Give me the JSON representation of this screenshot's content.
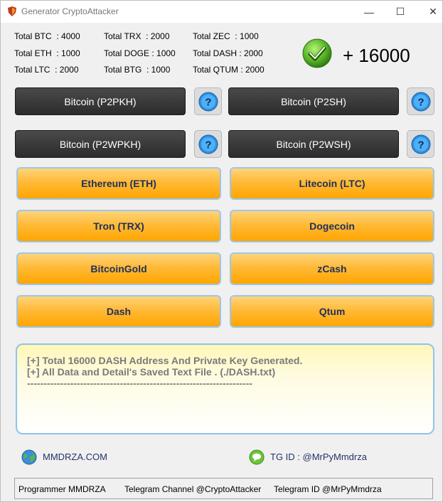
{
  "window": {
    "title": "Generator CryptoAttacker",
    "controls": {
      "minimize": "—",
      "maximize": "☐",
      "close": "✕"
    }
  },
  "totals": [
    [
      "Total BTC  : 4000",
      "Total TRX  : 2000",
      "Total ZEC  : 1000"
    ],
    [
      "Total ETH  : 1000",
      "Total DOGE : 1000",
      "Total DASH : 2000"
    ],
    [
      "Total LTC  : 2000",
      "Total BTG  : 1000",
      "Total QTUM : 2000"
    ]
  ],
  "counter": "+ 16000",
  "bitcoin_buttons": [
    {
      "label": "Bitcoin (P2PKH)"
    },
    {
      "label": "Bitcoin (P2SH)"
    },
    {
      "label": "Bitcoin (P2WPKH)"
    },
    {
      "label": "Bitcoin (P2WSH)"
    }
  ],
  "help_label": "?",
  "coin_buttons": [
    {
      "label": "Ethereum (ETH)"
    },
    {
      "label": "Litecoin (LTC)"
    },
    {
      "label": "Tron (TRX)"
    },
    {
      "label": "Dogecoin"
    },
    {
      "label": "BitcoinGold"
    },
    {
      "label": "zCash"
    },
    {
      "label": "Dash"
    },
    {
      "label": "Qtum"
    }
  ],
  "log": {
    "lines": [
      "[+] Total 16000 DASH Address And Private Key Generated.",
      "[+] All Data and Detail's Saved Text File . (./DASH.txt)",
      "--------------------------------------------------------------------"
    ]
  },
  "links": {
    "website": "MMDRZA.COM",
    "telegram": "TG ID : @MrPyMmdrza"
  },
  "status": {
    "programmer": "Programmer MMDRZA",
    "channel": "Telegram Channel @CryptoAttacker",
    "telegram_id": "Telegram ID @MrPyMmdrza"
  },
  "colors": {
    "accent_orange": "#ffa500",
    "dark_button": "#333333",
    "border_blue": "#8ec4ec",
    "link_text": "#24346a"
  },
  "icons": {
    "app": "shield-icon",
    "success": "check-icon",
    "help": "question-icon",
    "website": "globe-icon",
    "telegram": "chat-icon"
  }
}
